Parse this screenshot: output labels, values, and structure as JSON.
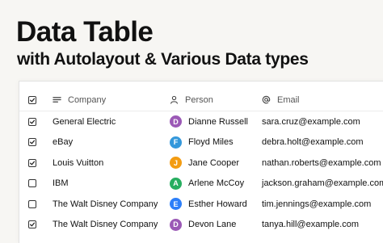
{
  "heading": {
    "title": "Data Table",
    "subtitle": "with Autolayout & Various Data types"
  },
  "table": {
    "columns": {
      "company": "Company",
      "person": "Person",
      "email": "Email"
    },
    "rows": [
      {
        "checked": true,
        "company": "General Electric",
        "initial": "D",
        "avatar_color": "#9b59b6",
        "person": "Dianne Russell",
        "email": "sara.cruz@example.com"
      },
      {
        "checked": true,
        "company": "eBay",
        "initial": "F",
        "avatar_color": "#3498db",
        "person": "Floyd Miles",
        "email": "debra.holt@example.com"
      },
      {
        "checked": true,
        "company": "Louis Vuitton",
        "initial": "J",
        "avatar_color": "#f39c12",
        "person": "Jane Cooper",
        "email": "nathan.roberts@example.com"
      },
      {
        "checked": false,
        "company": "IBM",
        "initial": "A",
        "avatar_color": "#27ae60",
        "person": "Arlene McCoy",
        "email": "jackson.graham@example.com"
      },
      {
        "checked": false,
        "company": "The Walt Disney Company",
        "initial": "E",
        "avatar_color": "#2d7ff9",
        "person": "Esther Howard",
        "email": "tim.jennings@example.com"
      },
      {
        "checked": true,
        "company": "The Walt Disney Company",
        "initial": "D",
        "avatar_color": "#9b59b6",
        "person": "Devon Lane",
        "email": "tanya.hill@example.com"
      }
    ]
  }
}
